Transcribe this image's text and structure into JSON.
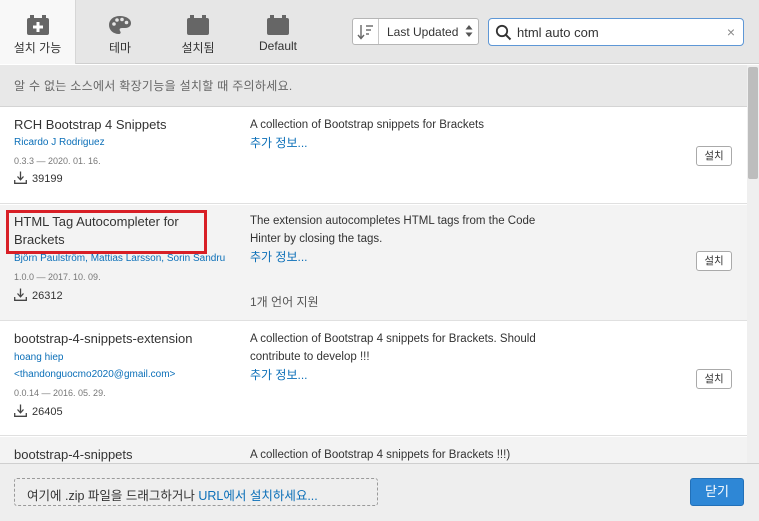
{
  "tabs": [
    {
      "label": "설치 가능",
      "icon": "plugin-add-icon"
    },
    {
      "label": "테마",
      "icon": "palette-icon"
    },
    {
      "label": "설치됨",
      "icon": "plugin-installed-icon"
    },
    {
      "label": "Default",
      "icon": "plugin-default-icon"
    }
  ],
  "sort": {
    "label": "Last Updated"
  },
  "search": {
    "value": "html auto com",
    "clear": "×"
  },
  "warning": "알 수 없는 소스에서 확장기능을 설치할 때 주의하세요.",
  "extensions": [
    {
      "name": "RCH Bootstrap 4 Snippets",
      "author": "Ricardo J Rodriguez",
      "version": "0.3.3 — 2020. 01. 16.",
      "downloads": "39199",
      "desc1": "A collection of Bootstrap snippets for Brackets",
      "more": "추가 정보...",
      "install": "설치"
    },
    {
      "name1": "HTML Tag Autocompleter for",
      "name2": "Brackets",
      "author": "Björn Paulström, Mattias Larsson, Sorin Sandru",
      "version": "1.0.0 — 2017. 10. 09.",
      "downloads": "26312",
      "desc1": "The extension autocompletes HTML tags from the Code",
      "desc2": "Hinter by closing the tags.",
      "more": "추가 정보...",
      "lang": "1개 언어 지원",
      "install": "설치"
    },
    {
      "name": "bootstrap-4-snippets-extension",
      "author1": "hoang hiep",
      "author2": "<thandonguocmo2020@gmail.com>",
      "version": "0.0.14 — 2016. 05. 29.",
      "downloads": "26405",
      "desc1": "A collection of Bootstrap 4 snippets for Brackets. Should",
      "desc2": "contribute to develop !!!",
      "more": "추가 정보...",
      "install": "설치"
    },
    {
      "name": "bootstrap-4-snippets",
      "desc1": "A collection of Bootstrap 4 snippets for Brackets !!!)"
    }
  ],
  "footer": {
    "drop_text": "여기에 .zip 파일을 드래그하거나 ",
    "drop_url": "URL에서 설치하세요...",
    "close": "닫기"
  },
  "colors": {
    "accent": "#2e87d6",
    "link": "#0b6fb8",
    "highlight": "#d81f26"
  }
}
